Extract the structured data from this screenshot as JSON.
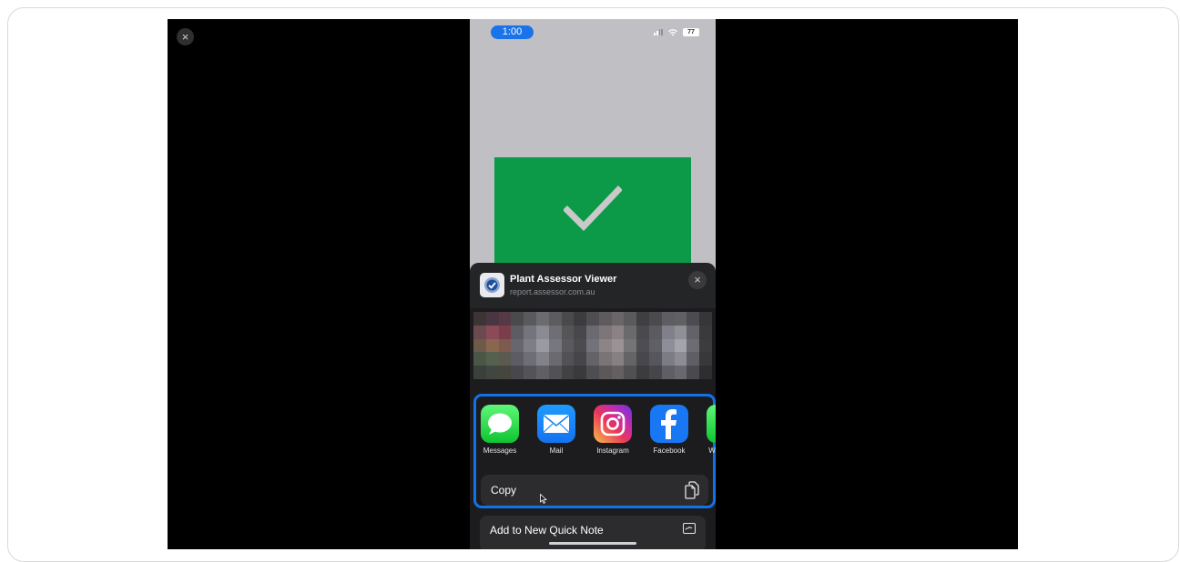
{
  "viewer": {
    "close_glyph": "×"
  },
  "status": {
    "time": "1:00",
    "battery": "77"
  },
  "header": {
    "title": "Plant Assessor Viewer",
    "url": "report.assessor.com.au",
    "close_glyph": "×"
  },
  "apps": [
    {
      "label": "Messages",
      "icon": "messages-icon"
    },
    {
      "label": "Mail",
      "icon": "mail-icon"
    },
    {
      "label": "Instagram",
      "icon": "instagram-icon"
    },
    {
      "label": "Facebook",
      "icon": "facebook-icon"
    },
    {
      "label": "W",
      "icon": "app-icon-partial"
    }
  ],
  "actions": {
    "copy_label": "Copy",
    "quick_note_label": "Add to New Quick Note"
  },
  "colors": {
    "highlight": "#1173ea",
    "success_green": "#0d9a48"
  }
}
